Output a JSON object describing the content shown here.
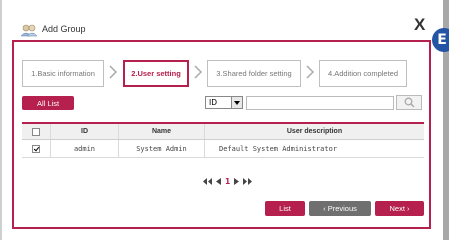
{
  "dialog": {
    "title": "Add Group",
    "close_label": "X",
    "badge_letter": "E",
    "accent": "#b5204e"
  },
  "steps": [
    {
      "label": "1.Basic information",
      "active": false
    },
    {
      "label": "2.User setting",
      "active": true
    },
    {
      "label": "3.Shared folder setting",
      "active": false
    },
    {
      "label": "4.Addition completed",
      "active": false
    }
  ],
  "toolbar": {
    "all_list_label": "All List",
    "search_field_value": "ID",
    "search_input_value": "",
    "search_icon": "magnifier-icon"
  },
  "table": {
    "headers": [
      "",
      "ID",
      "Name",
      "User description"
    ],
    "rows": [
      {
        "checked": true,
        "id": "admin",
        "name": "System Admin",
        "description": "Default System Administrator"
      }
    ]
  },
  "pagination": {
    "first_icon": "double-left-icon",
    "prev_icon": "left-arrow-icon",
    "current_page": "1",
    "next_icon": "right-arrow-icon",
    "last_icon": "double-right-icon"
  },
  "buttons": {
    "list": "List",
    "previous": "‹ Previous",
    "next": "Next ›"
  }
}
